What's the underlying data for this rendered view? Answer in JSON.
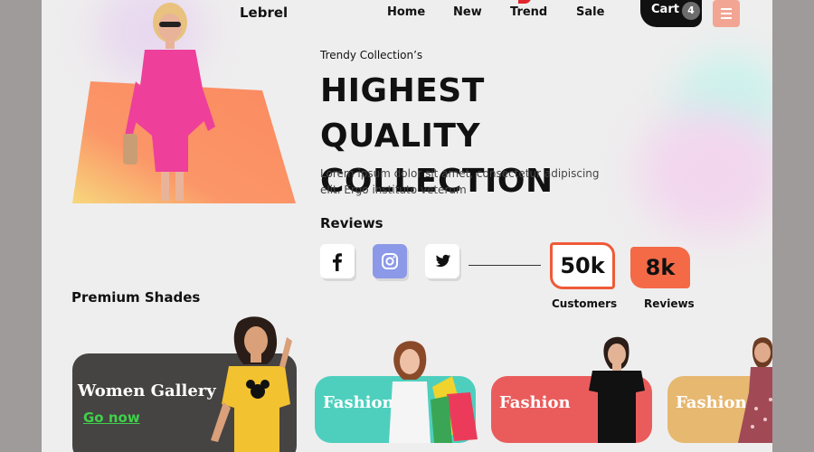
{
  "brand": {
    "name": "Lebrel"
  },
  "nav": {
    "items": [
      "Home",
      "New",
      "Trend",
      "Sale"
    ],
    "cart_label": "Cart",
    "cart_count": "4"
  },
  "hero": {
    "eyebrow": "Trendy Collection’s",
    "headline_line1": "HIGHEST QUALITY",
    "headline_line2": "COLLECTION",
    "description": "Lorem ipsum dolor sit amet, consectetur adipiscing elit. Ergo instituto veterum"
  },
  "reviews": {
    "title": "Reviews",
    "social_icons": [
      "facebook-icon",
      "instagram-icon",
      "twitter-icon"
    ],
    "stats": [
      {
        "value": "50k",
        "label": "Customers"
      },
      {
        "value": "8k",
        "label": "Reviews"
      }
    ]
  },
  "premium": {
    "title": "Premium Shades",
    "gallery_title": "Women Gallery",
    "gallery_link": "Go now",
    "cards": [
      {
        "label": "Fashion",
        "color": "#4ecfbe"
      },
      {
        "label": "Fashion",
        "color": "#ea5c5c"
      },
      {
        "label": "Fashion",
        "color": "#e6b870"
      }
    ]
  },
  "colors": {
    "accent": "#ef5a38",
    "dark": "#111111",
    "menu": "#f2a593",
    "highlight_green": "#3fd04a"
  }
}
